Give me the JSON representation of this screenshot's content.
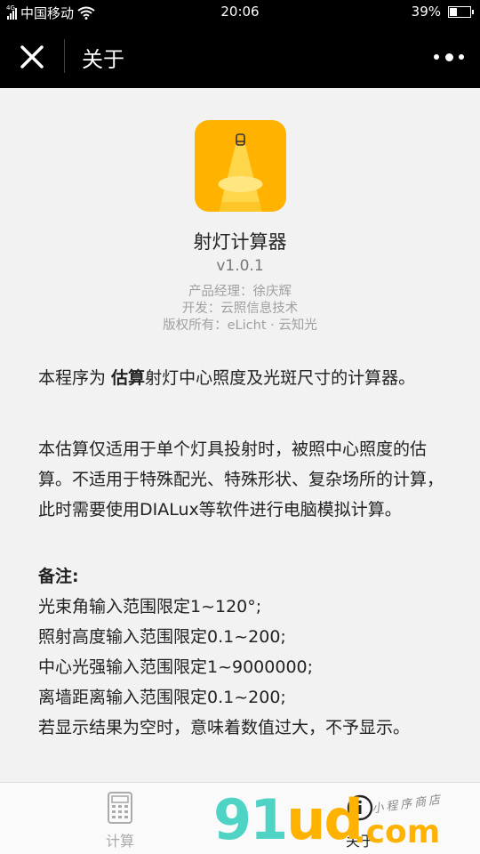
{
  "status_bar": {
    "network_type": "4G",
    "carrier": "中国移动",
    "time": "20:06",
    "battery": "39%",
    "battery_level": 0.39
  },
  "nav": {
    "title": "关于",
    "close_icon": "close-icon",
    "more_icon": "more-dots-icon"
  },
  "app": {
    "name": "射灯计算器",
    "version": "v1.0.1",
    "product_manager": "产品经理：徐庆辉",
    "developer": "开发：云照信息技术",
    "copyright": "版权所有：eLicht · 云知光",
    "icon": "spotlight-icon",
    "icon_color": "#ffb300"
  },
  "description": {
    "p1_before": "本程序为 ",
    "p1_bold": "估算",
    "p1_after": "射灯中心照度及光斑尺寸的计算器。",
    "p2": "本估算仅适用于单个灯具投射时，被照中心照度的估算。不适用于特殊配光、特殊形状、复杂场所的计算，此时需要使用DIALux等软件进行电脑模拟计算。"
  },
  "notes": {
    "title": "备注:",
    "items": [
      "光束角输入范围限定1~120°;",
      "照射高度输入范围限定0.1~200;",
      "中心光强输入范围限定1~9000000;",
      "离墙距离输入范围限定0.1~200;",
      "若显示结果为空时，意味着数值过大，不予显示。"
    ]
  },
  "tabbar": {
    "tabs": [
      {
        "label": "计算",
        "icon": "calculator-icon"
      },
      {
        "label": "关于",
        "icon": "info-icon"
      }
    ]
  },
  "watermark": {
    "logo_g": "91",
    "logo_u": "ud",
    "logo_dot": ".com",
    "sub": "小程序商店"
  }
}
